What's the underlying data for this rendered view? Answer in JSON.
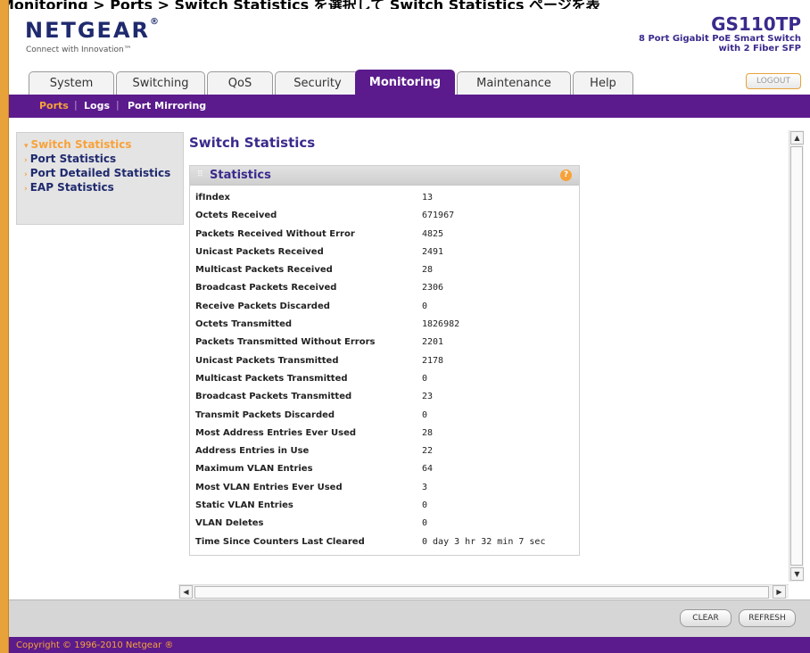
{
  "caption": "Monitoring > Ports > Switch Statistics を選択して Switch Statistics ページを表",
  "header": {
    "brand": "NETGEAR",
    "brand_mark": "®",
    "tagline": "Connect with Innovation™",
    "model_name": "GS110TP",
    "model_desc_line1": "8 Port Gigabit PoE Smart Switch",
    "model_desc_line2": "with 2 Fiber SFP"
  },
  "tabs": [
    {
      "label": "System",
      "active": false
    },
    {
      "label": "Switching",
      "active": false
    },
    {
      "label": "QoS",
      "active": false
    },
    {
      "label": "Security",
      "active": false
    },
    {
      "label": "Monitoring",
      "active": true
    },
    {
      "label": "Maintenance",
      "active": false
    },
    {
      "label": "Help",
      "active": false
    }
  ],
  "logout_label": "LOGOUT",
  "subnav": {
    "items": [
      {
        "label": "Ports",
        "active": true
      },
      {
        "label": "Logs",
        "active": false
      },
      {
        "label": "Port Mirroring",
        "active": false
      }
    ],
    "separator": "|"
  },
  "left_menu": {
    "items": [
      {
        "label": "Switch Statistics",
        "active": true
      },
      {
        "label": "Port Statistics",
        "active": false
      },
      {
        "label": "Port Detailed Statistics",
        "active": false
      },
      {
        "label": "EAP Statistics",
        "active": false
      }
    ]
  },
  "page_title": "Switch Statistics",
  "panel": {
    "title": "Statistics",
    "help_glyph": "?",
    "rows": [
      {
        "label": "ifIndex",
        "value": "13"
      },
      {
        "label": "Octets Received",
        "value": "671967"
      },
      {
        "label": "Packets Received Without Error",
        "value": "4825"
      },
      {
        "label": "Unicast Packets Received",
        "value": "2491"
      },
      {
        "label": "Multicast Packets Received",
        "value": "28"
      },
      {
        "label": "Broadcast Packets Received",
        "value": "2306"
      },
      {
        "label": "Receive Packets Discarded",
        "value": "0"
      },
      {
        "label": "Octets Transmitted",
        "value": "1826982"
      },
      {
        "label": "Packets Transmitted Without Errors",
        "value": "2201"
      },
      {
        "label": "Unicast Packets Transmitted",
        "value": "2178"
      },
      {
        "label": "Multicast Packets Transmitted",
        "value": "0"
      },
      {
        "label": "Broadcast Packets Transmitted",
        "value": "23"
      },
      {
        "label": "Transmit Packets Discarded",
        "value": "0"
      },
      {
        "label": "Most Address Entries Ever Used",
        "value": "28"
      },
      {
        "label": "Address Entries in Use",
        "value": "22"
      },
      {
        "label": "Maximum VLAN Entries",
        "value": "64"
      },
      {
        "label": "Most VLAN Entries Ever Used",
        "value": "3"
      },
      {
        "label": "Static VLAN Entries",
        "value": "0"
      },
      {
        "label": "VLAN Deletes",
        "value": "0"
      },
      {
        "label": "Time Since Counters Last Cleared",
        "value": "0 day 3 hr 32 min 7 sec"
      }
    ]
  },
  "buttons": {
    "clear": "CLEAR",
    "refresh": "REFRESH"
  },
  "footer": {
    "copyright": "Copyright © 1996-2010 Netgear ®"
  },
  "colors": {
    "brand_purple": "#5b1b8c",
    "accent_orange": "#f7a23a",
    "title_blue": "#3b2a8c"
  }
}
